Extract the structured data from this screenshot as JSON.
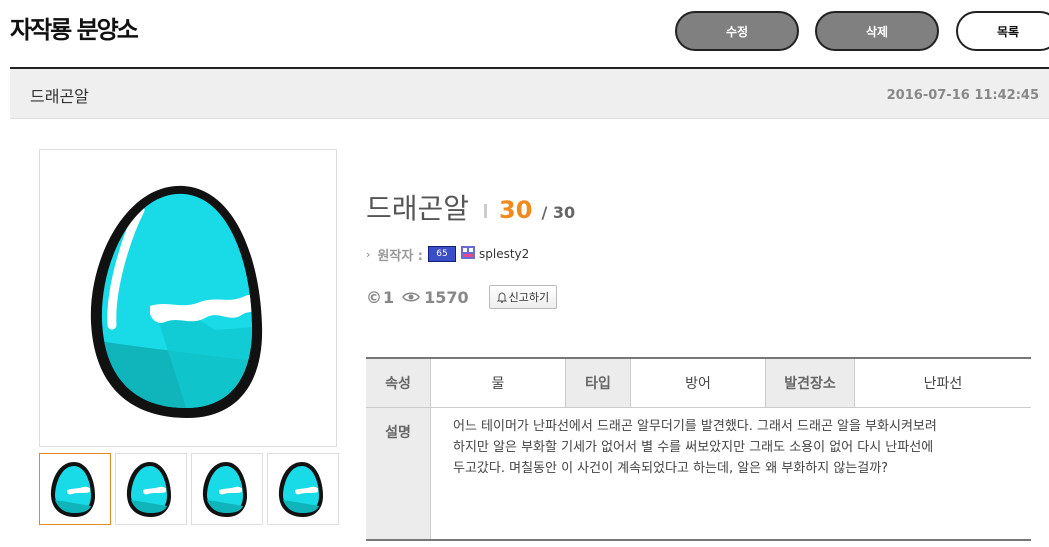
{
  "site": {
    "title": "자작룡 분양소"
  },
  "toolbar": {
    "edit_label": "수정",
    "delete_label": "삭제",
    "list_label": "목록"
  },
  "post": {
    "title": "드래곤알",
    "date": "2016-07-16 11:42:45"
  },
  "detail": {
    "name": "드래곤알",
    "score": "30",
    "score_total": "/ 30",
    "author_label": "원작자 :",
    "author_level": "65",
    "author_name": "splesty2",
    "comments": "1",
    "views": "1570",
    "report_label": "신고하기"
  },
  "table": {
    "attr_label": "속성",
    "attr_value": "물",
    "type_label": "타입",
    "type_value": "방어",
    "place_label": "발견장소",
    "place_value": "난파선",
    "desc_label": "설명",
    "desc_lines": [
      "어느 테이머가 난파선에서 드래곤 알무더기를 발견했다. 그래서 드래곤 알을 부화시켜보려",
      "하지만 알은 부화할 기세가 없어서 별 수를 써보았지만 그래도 소용이 없어 다시 난파선에",
      "두고갔다. 며칠동안 이 사건이 계속되었다고 하는데, 알은 왜 부화하지 않는걸까?"
    ]
  },
  "colors": {
    "egg_main": "#19dbe8",
    "egg_dark": "#0fb5ba",
    "score_accent": "#f08a1e",
    "active_thumb_border": "#e08a24"
  },
  "icons": [
    "copyright-icon",
    "eye-icon",
    "bell-icon",
    "bullet-icon",
    "avatar-icon"
  ]
}
